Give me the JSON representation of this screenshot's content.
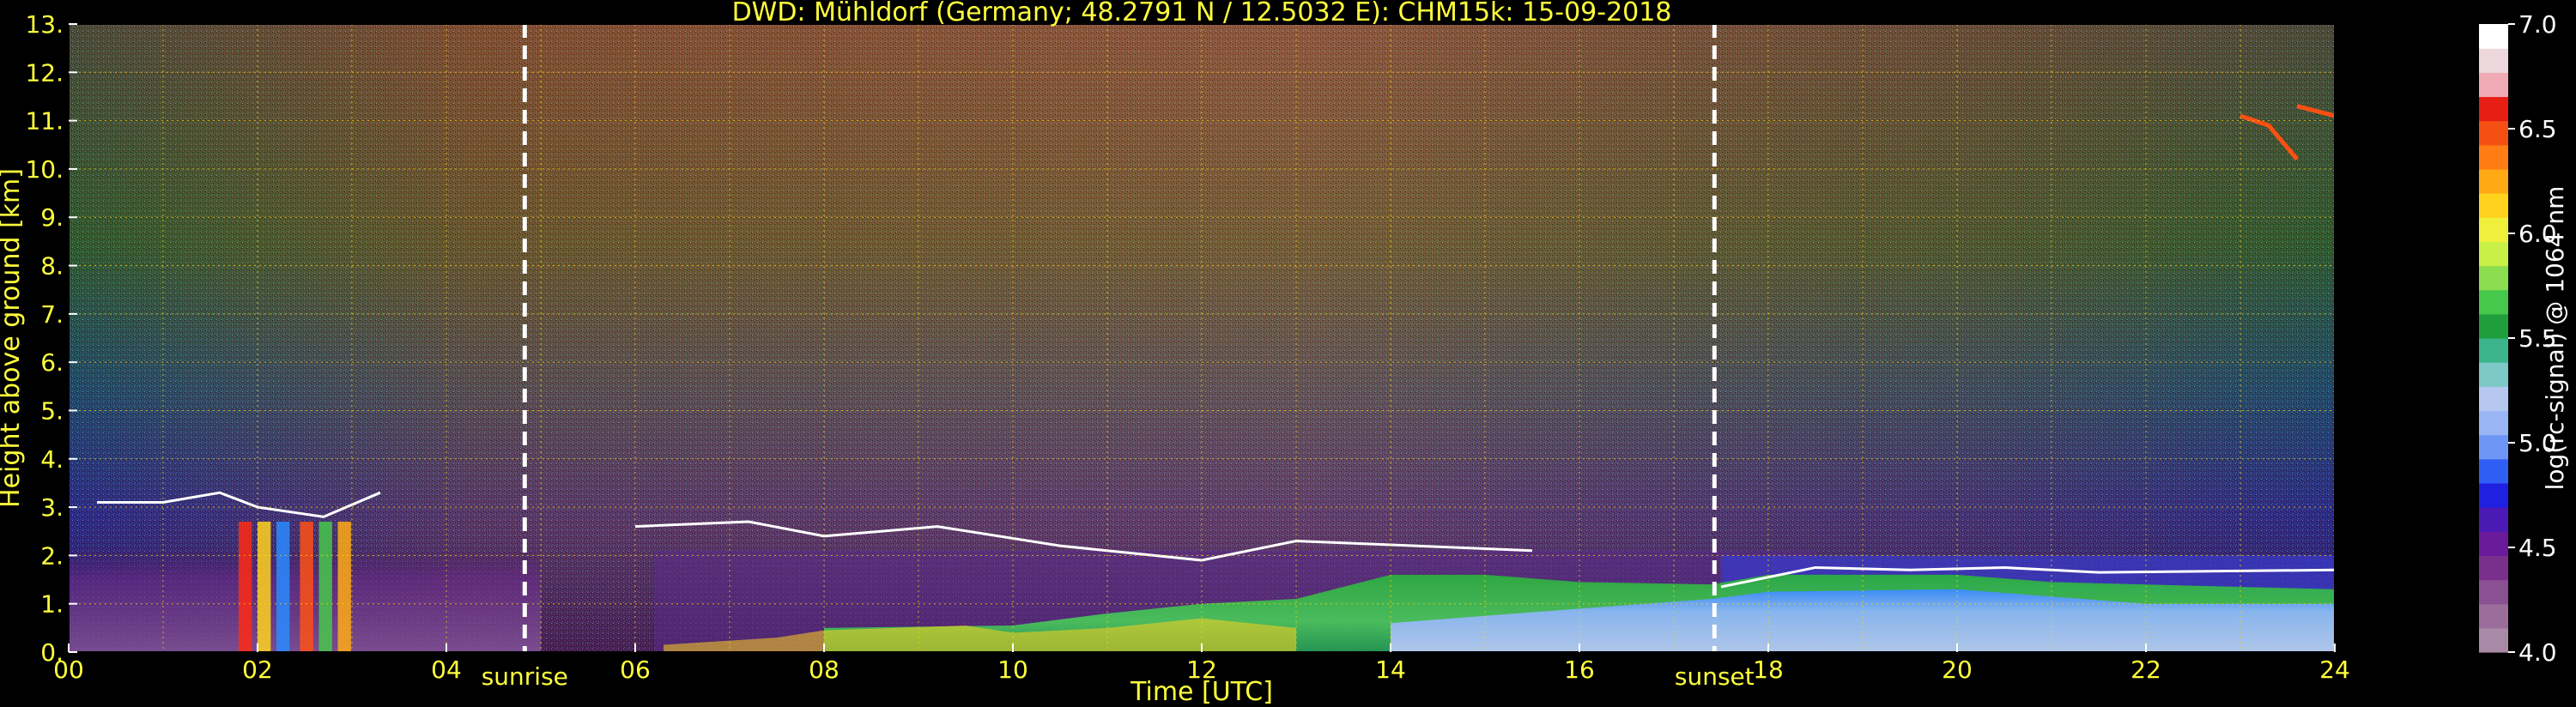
{
  "chart_data": {
    "type": "heatmap",
    "title": "DWD: Mühldorf (Germany; 48.2791 N / 12.5032 E):    CHM15k: 15-09-2018",
    "xlabel": "Time [UTC]",
    "ylabel": "Height above ground [km]",
    "xlim": [
      0,
      24
    ],
    "ylim": [
      0,
      13
    ],
    "x_ticks": [
      "00",
      "02",
      "04",
      "06",
      "08",
      "10",
      "12",
      "14",
      "16",
      "18",
      "20",
      "22",
      "24"
    ],
    "y_ticks": [
      "0.",
      "1.",
      "2.",
      "3.",
      "4.",
      "5.",
      "6.",
      "7.",
      "8.",
      "9.",
      "10.",
      "11.",
      "12.",
      "13."
    ],
    "grid": true,
    "markers": [
      {
        "label": "sunrise",
        "x": 4.83
      },
      {
        "label": "sunset",
        "x": 17.43
      }
    ],
    "colorbar": {
      "label": "log(rc-signal) @ 1064 nm",
      "range": [
        4.0,
        7.0
      ],
      "ticks": [
        "4.0",
        "4.5",
        "5.0",
        "5.5",
        "6.0",
        "6.5",
        "7.0"
      ],
      "colors": [
        "#a88aa6",
        "#9a6d9b",
        "#8b4f93",
        "#7b2f8c",
        "#6a1a9a",
        "#4b1ab4",
        "#2020e0",
        "#2f5ef5",
        "#6e96f5",
        "#9ab6f5",
        "#b6c8f0",
        "#7ec8c8",
        "#3cb48c",
        "#1e9e3c",
        "#46c84b",
        "#8cdc50",
        "#c8f046",
        "#f0f03c",
        "#ffd21e",
        "#ffaa14",
        "#ff7d14",
        "#f55014",
        "#e61e14",
        "#f0aab4",
        "#ebd7dc",
        "#ffffff"
      ]
    }
  }
}
